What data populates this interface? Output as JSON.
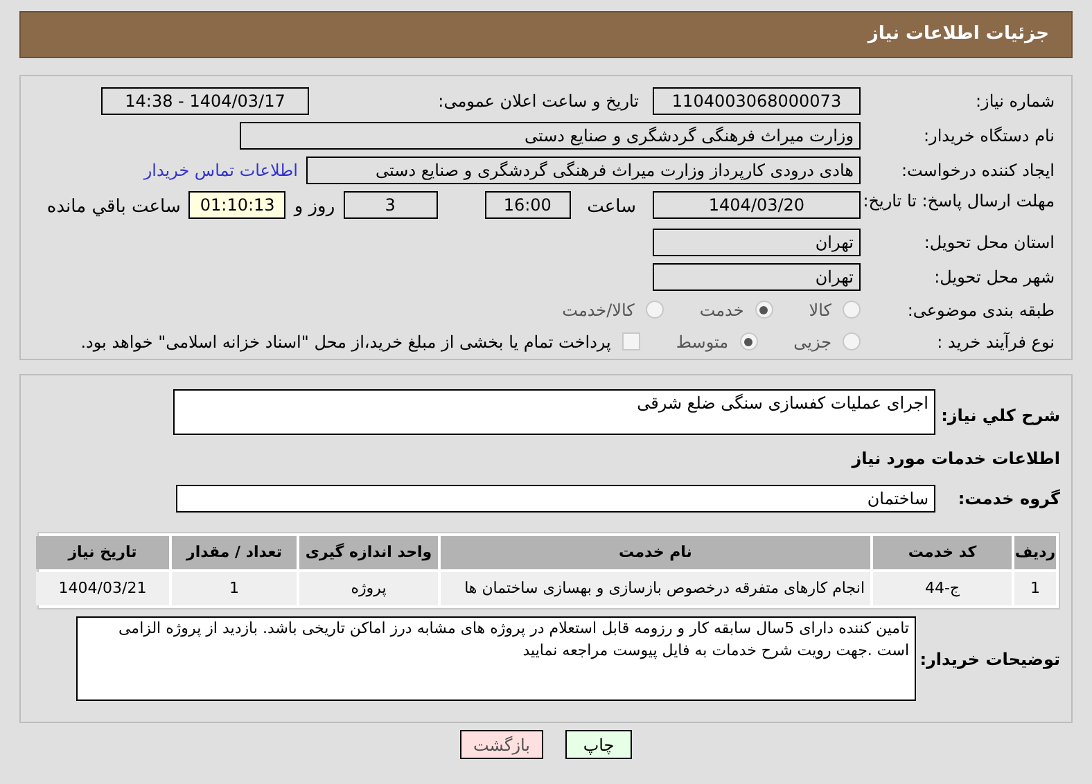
{
  "header": {
    "title": "جزئیات اطلاعات نیاز"
  },
  "fields": {
    "need_number": {
      "label": "شماره نیاز:",
      "value": "1104003068000073"
    },
    "announce": {
      "label": "تاریخ و ساعت اعلان عمومی:",
      "value": "1404/03/17 - 14:38"
    },
    "buyer": {
      "label": "نام دستگاه خریدار:",
      "value": "وزارت میراث فرهنگی  گردشگری و صنایع دستی"
    },
    "creator": {
      "label": "ایجاد کننده درخواست:",
      "value": "هادی درودی کارپرداز وزارت میراث فرهنگی  گردشگری و صنایع دستی",
      "link": "اطلاعات تماس خریدار"
    },
    "deadline": {
      "label": "مهلت ارسال پاسخ: تا تاریخ:",
      "date": "1404/03/20",
      "time_label": "ساعت",
      "time": "16:00",
      "days": "3",
      "days_label": "روز و",
      "remaining": "01:10:13",
      "remaining_label": "ساعت باقي مانده"
    },
    "province": {
      "label": "استان محل تحویل:",
      "value": "تهران"
    },
    "city": {
      "label": "شهر محل تحویل:",
      "value": "تهران"
    }
  },
  "category": {
    "label": "طبقه بندی موضوعی:",
    "options": [
      {
        "label": "کالا",
        "selected": false
      },
      {
        "label": "خدمت",
        "selected": true
      },
      {
        "label": "کالا/خدمت",
        "selected": false
      }
    ]
  },
  "process": {
    "label": "نوع فرآیند خرید :",
    "options": [
      {
        "label": "جزیی",
        "selected": false
      },
      {
        "label": "متوسط",
        "selected": true
      }
    ],
    "payment": {
      "checked": false,
      "text": "پرداخت تمام یا بخشی از مبلغ خرید،از محل \"اسناد خزانه اسلامی\" خواهد بود."
    }
  },
  "summary": {
    "label": "شرح کلي نیاز:",
    "value": "اجرای عملیات کفسازی سنگی ضلع شرقی"
  },
  "services_heading": "اطلاعات خدمات مورد نیاز",
  "service_group": {
    "label": "گروه خدمت:",
    "value": "ساختمان"
  },
  "table": {
    "columns": [
      "ردیف",
      "کد خدمت",
      "نام خدمت",
      "واحد اندازه گیری",
      "تعداد / مقدار",
      "تاریخ نیاز"
    ],
    "rows": [
      [
        "1",
        "ج-44",
        "انجام کارهای متفرقه درخصوص بازسازی و بهسازی ساختمان ها",
        "پروژه",
        "1",
        "1404/03/21"
      ]
    ]
  },
  "buyer_notes": {
    "label": "توضیحات خریدار:",
    "value": "تامین کننده دارای 5سال سابقه کار و رزومه قابل استعلام در پروژه های مشابه درز اماکن تاریخی باشد. بازدید از پروژه الزامی است .جهت رویت شرح خدمات به فایل پیوست مراجعه نمایید"
  },
  "buttons": [
    {
      "kind": "print",
      "label": "چاپ"
    },
    {
      "kind": "back",
      "label": "بازگشت"
    }
  ]
}
